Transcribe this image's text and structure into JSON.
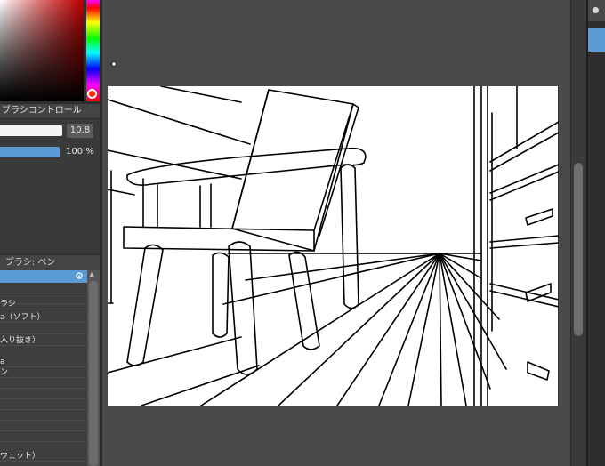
{
  "brush_control": {
    "header": "ブラシコントロール",
    "size_value": "10.8",
    "opacity_value": "100 %"
  },
  "brush_list": {
    "header": "ブラシ: ペン",
    "items": [
      "ラシ",
      "a（ソフト）",
      "入り抜き）",
      "a",
      "ン",
      "ウェット）"
    ]
  },
  "colors": {
    "accent": "#5b9bd5",
    "panel": "#3a3a3a",
    "canvas_bg": "#4a4a4a"
  },
  "icons": {
    "brush_settings": "gear-icon",
    "scroll_up": "chevron-up-icon"
  }
}
